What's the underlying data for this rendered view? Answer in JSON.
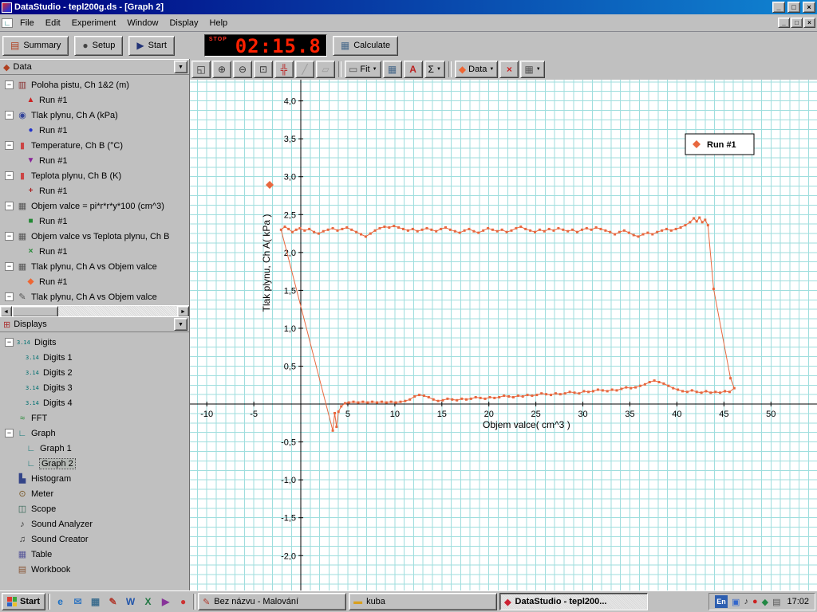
{
  "titlebar": {
    "title": "DataStudio - tepl200g.ds - [Graph 2]",
    "minimize": "_",
    "maximize": "□",
    "close": "×"
  },
  "menubar": {
    "items": [
      "File",
      "Edit",
      "Experiment",
      "Window",
      "Display",
      "Help"
    ],
    "mdi_minimize": "_",
    "mdi_restore": "□",
    "mdi_close": "×",
    "child_icon": "∟"
  },
  "toolbar": {
    "summary": "Summary",
    "setup": "Setup",
    "start": "Start",
    "calculate": "Calculate",
    "timer_label": "STOP",
    "timer_value": "02:15.8",
    "summary_icon": "▤",
    "setup_icon": "●",
    "start_icon": "▶",
    "calculate_icon": "▦"
  },
  "graph_toolbar": {
    "buttons": [
      {
        "glyph": "◱",
        "color": "#333333"
      },
      {
        "glyph": "⊕",
        "color": "#333333"
      },
      {
        "glyph": "⊖",
        "color": "#333333"
      },
      {
        "glyph": "⊡",
        "color": "#333333"
      },
      {
        "glyph": "╬",
        "color": "#bb2222"
      },
      {
        "glyph": "╱",
        "color": "#999999"
      },
      {
        "glyph": "▱",
        "color": "#999999"
      },
      {
        "glyph": "▭",
        "color": "#555555",
        "label": "Fit",
        "arrow": "▼"
      },
      {
        "glyph": "▦",
        "color": "#446688"
      },
      {
        "glyph": "A",
        "color": "#bb2222"
      },
      {
        "glyph": "Σ",
        "color": "#000000",
        "arrow": "▼"
      },
      {
        "glyph": "◆",
        "color": "#ee6633",
        "label": "Data",
        "arrow": "▼"
      },
      {
        "glyph": "×",
        "color": "#cc2222"
      },
      {
        "glyph": "▦",
        "color": "#555555",
        "arrow": "▼"
      }
    ]
  },
  "data_panel": {
    "title": "Data",
    "header_icon": "◆",
    "header_icon_color": "#b04020",
    "items": [
      {
        "label": "Poloha pistu, Ch 1&2 (m)",
        "icon": "▥",
        "icon_color": "#8a3333",
        "run": "Run #1",
        "marker": "▲",
        "marker_color": "#cc2222"
      },
      {
        "label": "Tlak plynu, Ch A (kPa)",
        "icon": "◉",
        "icon_color": "#334499",
        "run": "Run #1",
        "marker": "●",
        "marker_color": "#2233cc"
      },
      {
        "label": "Temperature, Ch B (°C)",
        "icon": "▮",
        "icon_color": "#cc4444",
        "run": "Run #1",
        "marker": "▼",
        "marker_color": "#882299"
      },
      {
        "label": "Teplota plynu, Ch B (K)",
        "icon": "▮",
        "icon_color": "#cc4444",
        "run": "Run #1",
        "marker": "+",
        "marker_color": "#aa2222"
      },
      {
        "label": "Objem valce = pi*r*r*y*100 (cm^3)",
        "icon": "▦",
        "icon_color": "#555555",
        "run": "Run #1",
        "marker": "■",
        "marker_color": "#228833"
      },
      {
        "label": "Objem valce vs Teplota plynu, Ch B",
        "icon": "▦",
        "icon_color": "#555555",
        "run": "Run #1",
        "marker": "×",
        "marker_color": "#228833"
      },
      {
        "label": "Tlak plynu, Ch A vs Objem valce",
        "icon": "▦",
        "icon_color": "#555555",
        "run": "Run #1",
        "marker": "◆",
        "marker_color": "#ee6633"
      },
      {
        "label": "Tlak plynu, Ch A vs Objem valce",
        "icon": "✎",
        "icon_color": "#555555"
      }
    ]
  },
  "displays_panel": {
    "title": "Displays",
    "header_icon": "⊞",
    "header_icon_color": "#aa3333",
    "items": [
      {
        "label": "Digits",
        "icon": "3.14"
      },
      {
        "label": "Digits 1",
        "icon": "3.14"
      },
      {
        "label": "Digits 2",
        "icon": "3.14"
      },
      {
        "label": "Digits 3",
        "icon": "3.14"
      },
      {
        "label": "Digits 4",
        "icon": "3.14"
      },
      {
        "label": "FFT",
        "icon": "≈",
        "icon_color": "#228833"
      },
      {
        "label": "Graph",
        "icon": "∟",
        "icon_color": "#117777"
      },
      {
        "label": "Graph 1",
        "icon": "∟",
        "icon_color": "#117777"
      },
      {
        "label": "Graph 2",
        "icon": "∟",
        "icon_color": "#117777"
      },
      {
        "label": "Histogram",
        "icon": "▙",
        "icon_color": "#334488"
      },
      {
        "label": "Meter",
        "icon": "⊙",
        "icon_color": "#775522"
      },
      {
        "label": "Scope",
        "icon": "◫",
        "icon_color": "#336655"
      },
      {
        "label": "Sound Analyzer",
        "icon": "♪",
        "icon_color": "#333333"
      },
      {
        "label": "Sound Creator",
        "icon": "♫",
        "icon_color": "#333333"
      },
      {
        "label": "Table",
        "icon": "▦",
        "icon_color": "#555599"
      },
      {
        "label": "Workbook",
        "icon": "▤",
        "icon_color": "#885533"
      }
    ]
  },
  "chart_data": {
    "type": "scatter",
    "title": "",
    "xlabel": "Objem valce( cm^3 )",
    "ylabel": "Tlak plynu, Ch A( kPa )",
    "legend": [
      "Run #1"
    ],
    "legend_position": "top-right",
    "series_color": "#e8683f",
    "grid_color": "#9fdede",
    "grid": true,
    "xlim": [
      -11.8,
      54.9
    ],
    "ylim": [
      -2.46,
      4.28
    ],
    "xticks": [
      -10,
      -5,
      5,
      10,
      15,
      20,
      25,
      30,
      35,
      40,
      45,
      50
    ],
    "ytick_values": [
      4.0,
      3.5,
      3.0,
      2.5,
      2.0,
      1.5,
      1.0,
      0.5,
      -0.5,
      -1.0,
      -1.5,
      -2.0
    ],
    "ytick_labels": [
      "4,0",
      "3,5",
      "3,0",
      "2,5",
      "2,0",
      "1,5",
      "1,0",
      "0,5",
      "-0,5",
      "-1,0",
      "-1,5",
      "-2,0"
    ],
    "closed": true,
    "points": [
      [
        -2.1,
        2.3
      ],
      [
        -1.7,
        2.34
      ],
      [
        -1.3,
        2.31
      ],
      [
        -0.9,
        2.27
      ],
      [
        -0.5,
        2.3
      ],
      [
        -0.1,
        2.32
      ],
      [
        0.4,
        2.29
      ],
      [
        0.9,
        2.31
      ],
      [
        1.4,
        2.27
      ],
      [
        1.9,
        2.25
      ],
      [
        2.4,
        2.28
      ],
      [
        2.9,
        2.3
      ],
      [
        3.4,
        2.32
      ],
      [
        3.9,
        2.29
      ],
      [
        4.4,
        2.31
      ],
      [
        4.9,
        2.33
      ],
      [
        5.4,
        2.3
      ],
      [
        5.9,
        2.27
      ],
      [
        6.4,
        2.24
      ],
      [
        6.9,
        2.21
      ],
      [
        7.4,
        2.25
      ],
      [
        7.9,
        2.29
      ],
      [
        8.4,
        2.32
      ],
      [
        8.9,
        2.34
      ],
      [
        9.4,
        2.33
      ],
      [
        9.9,
        2.35
      ],
      [
        10.4,
        2.33
      ],
      [
        10.9,
        2.31
      ],
      [
        11.4,
        2.29
      ],
      [
        11.9,
        2.31
      ],
      [
        12.4,
        2.28
      ],
      [
        12.9,
        2.3
      ],
      [
        13.4,
        2.32
      ],
      [
        13.9,
        2.3
      ],
      [
        14.4,
        2.28
      ],
      [
        14.9,
        2.31
      ],
      [
        15.4,
        2.33
      ],
      [
        15.9,
        2.3
      ],
      [
        16.4,
        2.28
      ],
      [
        16.9,
        2.26
      ],
      [
        17.4,
        2.29
      ],
      [
        17.9,
        2.31
      ],
      [
        18.4,
        2.28
      ],
      [
        18.9,
        2.26
      ],
      [
        19.4,
        2.29
      ],
      [
        19.9,
        2.32
      ],
      [
        20.4,
        2.3
      ],
      [
        20.9,
        2.28
      ],
      [
        21.4,
        2.3
      ],
      [
        21.9,
        2.27
      ],
      [
        22.4,
        2.29
      ],
      [
        22.9,
        2.32
      ],
      [
        23.4,
        2.34
      ],
      [
        23.9,
        2.31
      ],
      [
        24.4,
        2.29
      ],
      [
        24.9,
        2.27
      ],
      [
        25.4,
        2.3
      ],
      [
        25.9,
        2.28
      ],
      [
        26.4,
        2.31
      ],
      [
        26.9,
        2.29
      ],
      [
        27.4,
        2.32
      ],
      [
        27.9,
        2.3
      ],
      [
        28.4,
        2.28
      ],
      [
        28.9,
        2.3
      ],
      [
        29.4,
        2.27
      ],
      [
        29.9,
        2.3
      ],
      [
        30.4,
        2.32
      ],
      [
        30.9,
        2.3
      ],
      [
        31.4,
        2.33
      ],
      [
        31.9,
        2.31
      ],
      [
        32.4,
        2.29
      ],
      [
        32.9,
        2.27
      ],
      [
        33.4,
        2.24
      ],
      [
        33.9,
        2.27
      ],
      [
        34.4,
        2.29
      ],
      [
        34.9,
        2.26
      ],
      [
        35.4,
        2.23
      ],
      [
        35.9,
        2.21
      ],
      [
        36.4,
        2.24
      ],
      [
        36.9,
        2.26
      ],
      [
        37.4,
        2.24
      ],
      [
        37.9,
        2.27
      ],
      [
        38.4,
        2.29
      ],
      [
        38.9,
        2.31
      ],
      [
        39.4,
        2.29
      ],
      [
        39.9,
        2.31
      ],
      [
        40.4,
        2.33
      ],
      [
        40.9,
        2.36
      ],
      [
        41.4,
        2.4
      ],
      [
        41.8,
        2.45
      ],
      [
        42.1,
        2.41
      ],
      [
        42.4,
        2.46
      ],
      [
        42.7,
        2.4
      ],
      [
        43.0,
        2.43
      ],
      [
        43.3,
        2.36
      ],
      [
        43.9,
        1.52
      ],
      [
        45.7,
        0.34
      ],
      [
        46.1,
        0.21
      ],
      [
        45.6,
        0.16
      ],
      [
        45.1,
        0.17
      ],
      [
        44.6,
        0.15
      ],
      [
        44.1,
        0.16
      ],
      [
        43.6,
        0.15
      ],
      [
        43.1,
        0.17
      ],
      [
        42.6,
        0.15
      ],
      [
        42.1,
        0.16
      ],
      [
        41.6,
        0.18
      ],
      [
        41.1,
        0.16
      ],
      [
        40.6,
        0.17
      ],
      [
        40.1,
        0.19
      ],
      [
        39.6,
        0.21
      ],
      [
        39.1,
        0.24
      ],
      [
        38.6,
        0.27
      ],
      [
        38.1,
        0.29
      ],
      [
        37.6,
        0.31
      ],
      [
        37.1,
        0.29
      ],
      [
        36.6,
        0.26
      ],
      [
        36.1,
        0.24
      ],
      [
        35.6,
        0.22
      ],
      [
        35.1,
        0.21
      ],
      [
        34.6,
        0.22
      ],
      [
        34.1,
        0.2
      ],
      [
        33.6,
        0.18
      ],
      [
        33.1,
        0.19
      ],
      [
        32.6,
        0.17
      ],
      [
        32.1,
        0.18
      ],
      [
        31.6,
        0.19
      ],
      [
        31.1,
        0.17
      ],
      [
        30.6,
        0.16
      ],
      [
        30.1,
        0.17
      ],
      [
        29.6,
        0.14
      ],
      [
        29.1,
        0.15
      ],
      [
        28.6,
        0.16
      ],
      [
        28.1,
        0.14
      ],
      [
        27.6,
        0.13
      ],
      [
        27.1,
        0.14
      ],
      [
        26.6,
        0.12
      ],
      [
        26.1,
        0.13
      ],
      [
        25.6,
        0.14
      ],
      [
        25.1,
        0.12
      ],
      [
        24.6,
        0.11
      ],
      [
        24.1,
        0.12
      ],
      [
        23.6,
        0.1
      ],
      [
        23.1,
        0.11
      ],
      [
        22.6,
        0.09
      ],
      [
        22.1,
        0.1
      ],
      [
        21.6,
        0.11
      ],
      [
        21.1,
        0.09
      ],
      [
        20.6,
        0.08
      ],
      [
        20.1,
        0.09
      ],
      [
        19.6,
        0.07
      ],
      [
        19.1,
        0.08
      ],
      [
        18.6,
        0.09
      ],
      [
        18.1,
        0.07
      ],
      [
        17.6,
        0.06
      ],
      [
        17.1,
        0.07
      ],
      [
        16.6,
        0.05
      ],
      [
        16.1,
        0.06
      ],
      [
        15.6,
        0.07
      ],
      [
        15.1,
        0.05
      ],
      [
        14.6,
        0.04
      ],
      [
        14.1,
        0.06
      ],
      [
        13.6,
        0.09
      ],
      [
        13.1,
        0.11
      ],
      [
        12.6,
        0.12
      ],
      [
        12.1,
        0.1
      ],
      [
        11.6,
        0.06
      ],
      [
        11.1,
        0.04
      ],
      [
        10.6,
        0.03
      ],
      [
        10.1,
        0.02
      ],
      [
        9.6,
        0.03
      ],
      [
        9.1,
        0.02
      ],
      [
        8.6,
        0.03
      ],
      [
        8.1,
        0.02
      ],
      [
        7.6,
        0.03
      ],
      [
        7.1,
        0.02
      ],
      [
        6.6,
        0.03
      ],
      [
        6.1,
        0.02
      ],
      [
        5.6,
        0.03
      ],
      [
        5.1,
        0.02
      ],
      [
        4.7,
        0.01
      ],
      [
        4.3,
        -0.03
      ],
      [
        4.0,
        -0.1
      ],
      [
        3.8,
        -0.3
      ],
      [
        3.6,
        -0.12
      ],
      [
        3.4,
        -0.35
      ]
    ]
  },
  "taskbar": {
    "start": "Start",
    "quicklaunch": [
      {
        "glyph": "e",
        "color": "#1a6fc4"
      },
      {
        "glyph": "✉",
        "color": "#3a7abf"
      },
      {
        "glyph": "▦",
        "color": "#3f6f8f"
      },
      {
        "glyph": "✎",
        "color": "#b03a2e"
      },
      {
        "glyph": "W",
        "color": "#2255aa"
      },
      {
        "glyph": "X",
        "color": "#227744"
      },
      {
        "glyph": "▶",
        "color": "#883399"
      },
      {
        "glyph": "●",
        "color": "#cc3333"
      }
    ],
    "tasks": [
      {
        "label": "Bez názvu - Malování",
        "icon": "✎",
        "icon_color": "#b03a2e"
      },
      {
        "label": "kuba",
        "icon": "▬",
        "icon_color": "#d8a020"
      },
      {
        "label": "DataStudio - tepl200...",
        "icon": "◆",
        "icon_color": "#cc2233"
      }
    ],
    "tray": {
      "lang": "En",
      "icons": [
        {
          "glyph": "▣",
          "color": "#3366cc"
        },
        {
          "glyph": "♪",
          "color": "#333333"
        },
        {
          "glyph": "●",
          "color": "#cc2222"
        },
        {
          "glyph": "◆",
          "color": "#228844"
        },
        {
          "glyph": "▤",
          "color": "#555555"
        }
      ],
      "clock": "17:02"
    }
  },
  "ui": {
    "minus": "−",
    "dropdown": "▼",
    "left_arrow": "◄",
    "right_arrow": "►"
  }
}
